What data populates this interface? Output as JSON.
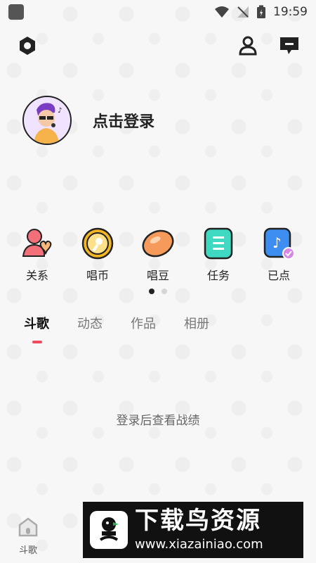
{
  "status_bar": {
    "time": "19:59"
  },
  "profile": {
    "login_label": "点击登录"
  },
  "quick_actions": [
    {
      "label": "关系",
      "icon": "relationship-icon"
    },
    {
      "label": "唱币",
      "icon": "sing-coin-icon"
    },
    {
      "label": "唱豆",
      "icon": "sing-bean-icon"
    },
    {
      "label": "任务",
      "icon": "task-icon"
    },
    {
      "label": "已点",
      "icon": "ordered-songs-icon"
    }
  ],
  "tabs": [
    "斗歌",
    "动态",
    "作品",
    "相册"
  ],
  "empty_state": {
    "message": "登录后查看战绩"
  },
  "bottom_nav": [
    {
      "label": "斗歌",
      "icon": "home-icon"
    }
  ],
  "watermark": {
    "title": "下载鸟资源",
    "url": "www.xiazainiao.com"
  }
}
